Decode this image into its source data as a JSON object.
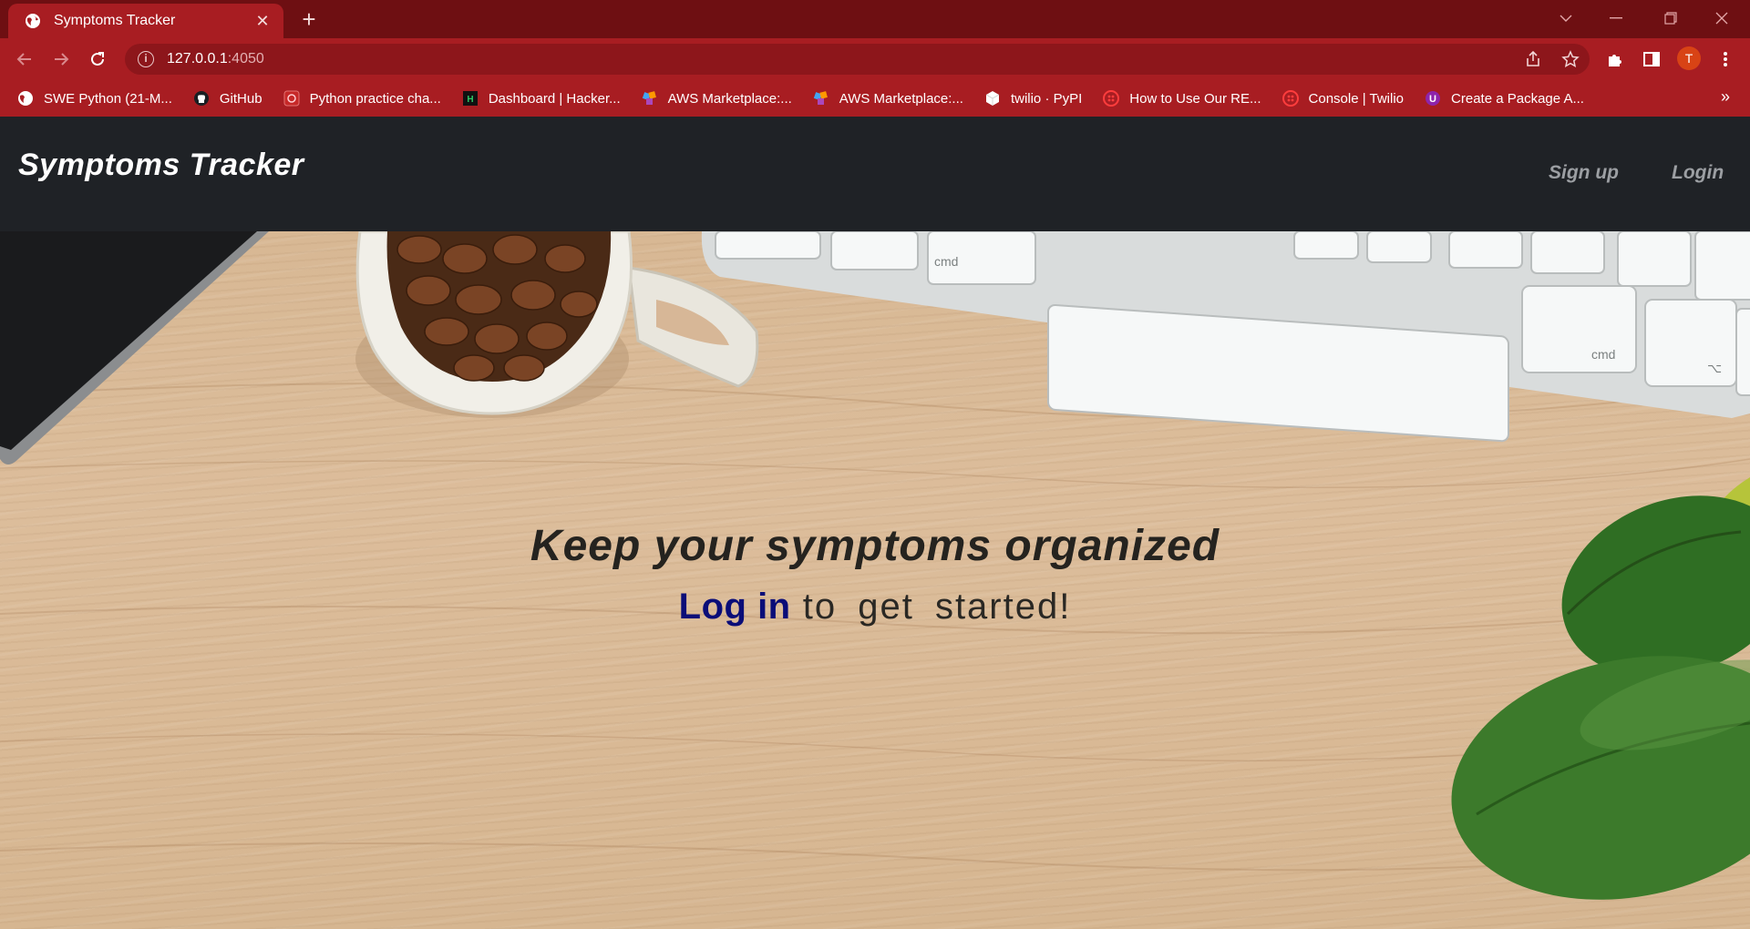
{
  "browser": {
    "tab": {
      "title": "Symptoms Tracker",
      "icon": "globe-icon"
    },
    "address": {
      "host": "127.0.0.1",
      "port": ":4050"
    },
    "profile_initial": "T",
    "bookmarks": [
      {
        "label": "SWE Python (21-M...",
        "icon": "globe-icon"
      },
      {
        "label": "GitHub",
        "icon": "github-icon"
      },
      {
        "label": "Python practice cha...",
        "icon": "python-practice-icon"
      },
      {
        "label": "Dashboard | Hacker...",
        "icon": "hackerrank-icon"
      },
      {
        "label": "AWS Marketplace:...",
        "icon": "aws-icon"
      },
      {
        "label": "AWS Marketplace:...",
        "icon": "aws-icon"
      },
      {
        "label": "twilio · PyPI",
        "icon": "pypi-icon"
      },
      {
        "label": "How to Use Our RE...",
        "icon": "twilio-icon"
      },
      {
        "label": "Console | Twilio",
        "icon": "twilio-icon"
      },
      {
        "label": "Create a Package A...",
        "icon": "package-icon"
      }
    ]
  },
  "navbar": {
    "brand": "Symptoms Tracker",
    "links": {
      "signup": "Sign up",
      "login": "Login"
    }
  },
  "hero": {
    "title": "Keep your symptoms organized",
    "cta_link": "Log in",
    "cta_rest": "to get started!"
  },
  "colors": {
    "chrome_accent": "#a81d22",
    "navbar_bg": "#1f2226",
    "link": "#0a0d78"
  }
}
